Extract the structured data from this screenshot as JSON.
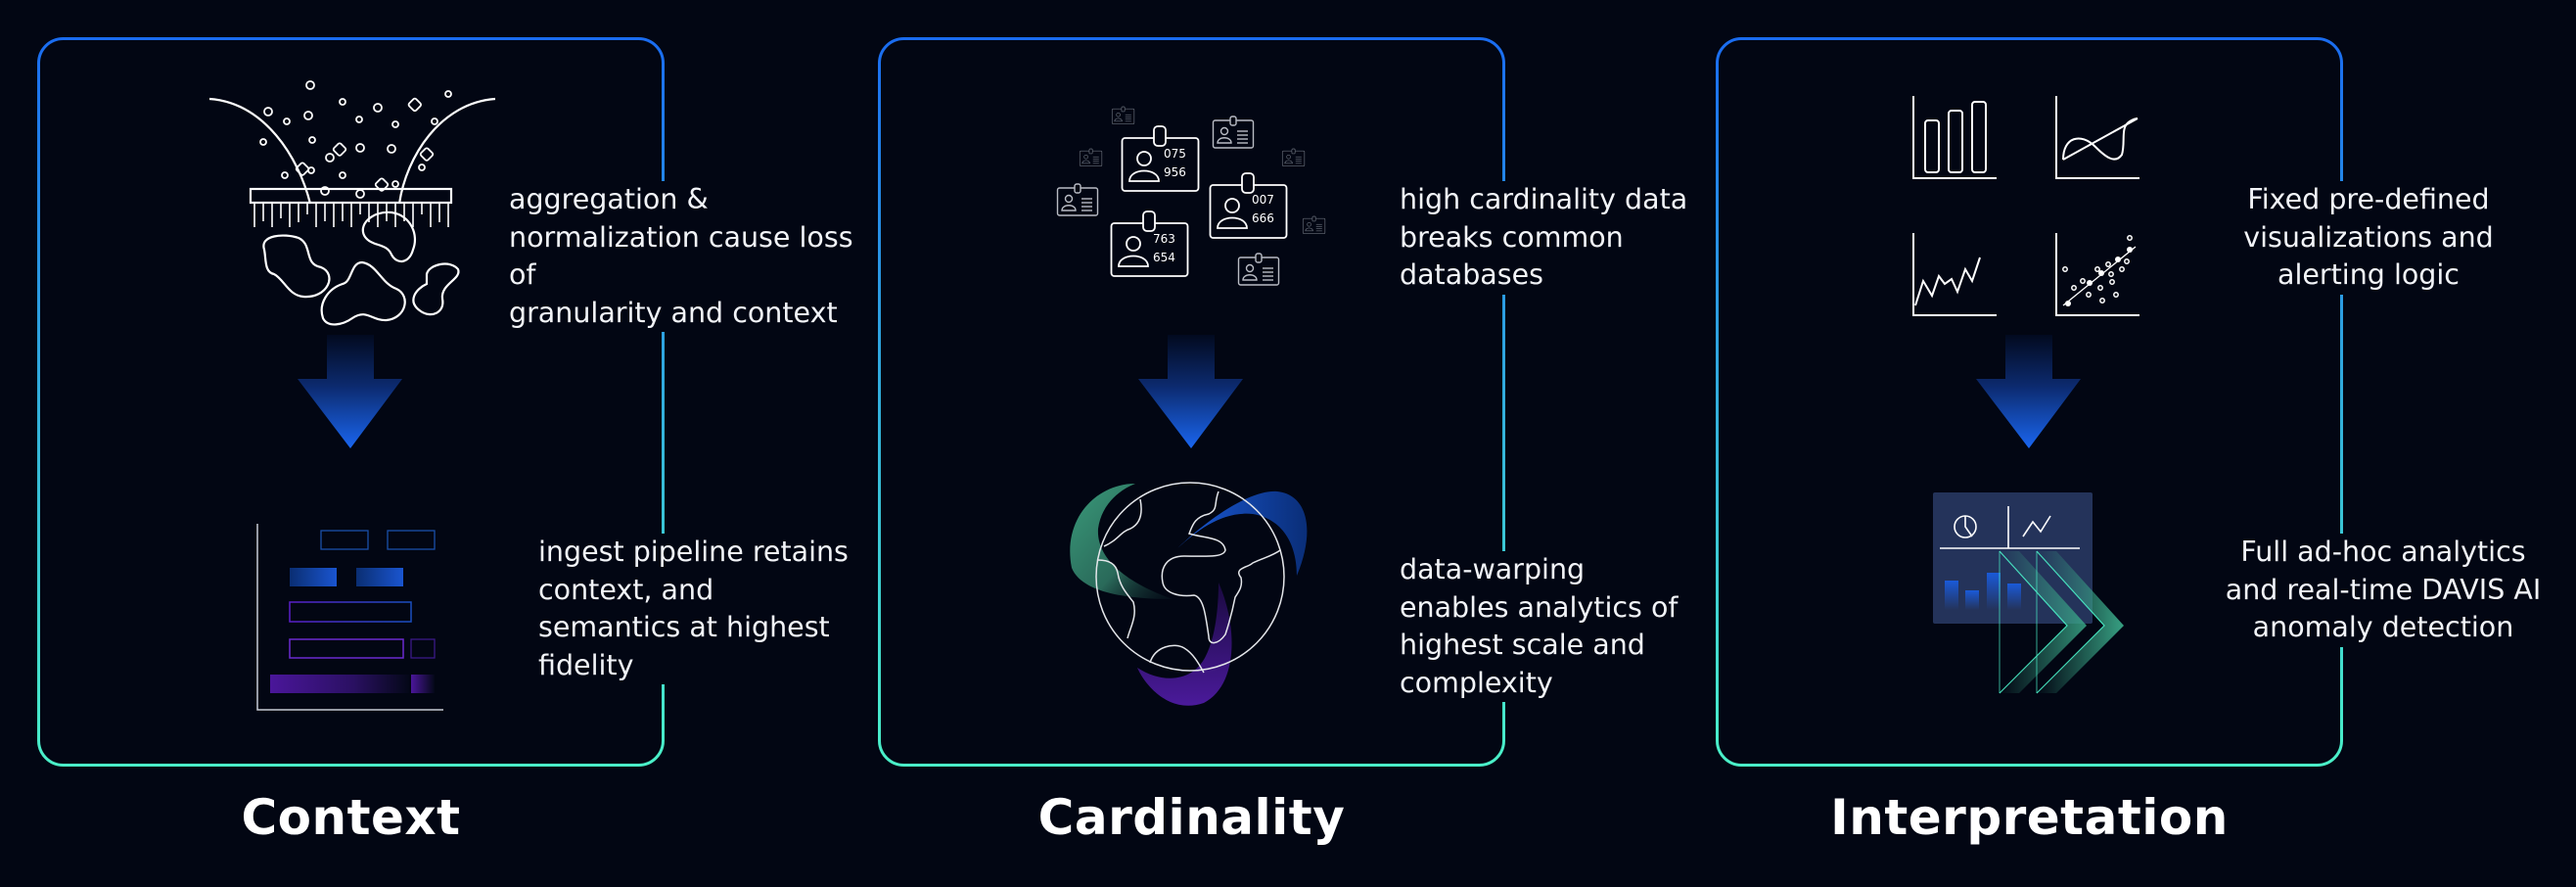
{
  "theme": {
    "background": "#020613",
    "border_top_color": "#1a6cf0",
    "border_bottom_color": "#4af0c8",
    "arrow_top_color": "#020a1f",
    "arrow_bottom_color": "#1a66f0"
  },
  "cards": [
    {
      "title": "Context",
      "top_text": "aggregation &\nnormalization cause loss\nof\ngranularity and context",
      "bottom_text": "ingest pipeline retains\ncontext, and\nsemantics at highest\nfidelity",
      "top_icon": "funnel-filter-icon",
      "bottom_icon": "layered-bar-chart-icon"
    },
    {
      "title": "Cardinality",
      "top_text": "high cardinality data\nbreaks common\ndatabases",
      "bottom_text": "data-warping\nenables analytics of\nhighest scale and\ncomplexity",
      "top_icon": "id-badges-icon",
      "bottom_icon": "globe-icon",
      "badges": [
        {
          "line1": "075",
          "line2": "956"
        },
        {
          "line1": "007",
          "line2": "666"
        },
        {
          "line1": "763",
          "line2": "654"
        }
      ]
    },
    {
      "title": "Interpretation",
      "top_text": "Fixed pre-defined\nvisualizations and\nalerting logic",
      "bottom_text": "Full ad-hoc analytics\nand real-time DAVIS AI\nanomaly detection",
      "top_icon": "chart-types-icon",
      "bottom_icon": "dashboard-chevron-icon"
    }
  ]
}
